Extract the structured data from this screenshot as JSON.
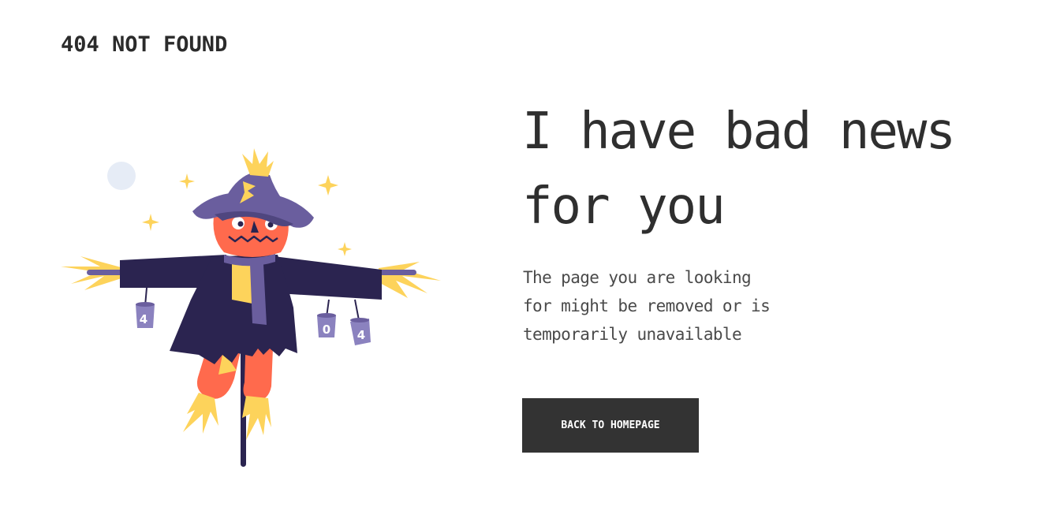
{
  "header": {
    "brand_text": "404 NOT FOUND"
  },
  "main": {
    "headline_line1": "I have bad news",
    "headline_line2": "for you",
    "description_line1": "The page you are looking",
    "description_line2": "for might be removed or is",
    "description_line3": "temporarily unavailable",
    "cta_label": "BACK TO HOMEPAGE"
  },
  "illustration": {
    "can_left_label": "4",
    "can_middle_label": "0",
    "can_right_label": "4",
    "colors": {
      "hat": "#6a5e9e",
      "hat_dark": "#4f467f",
      "coat": "#2b2450",
      "face": "#ff6a4d",
      "straw": "#fdd35b",
      "scarf": "#6a5e9e",
      "moon": "#e6ecf6",
      "pole": "#2b2450"
    }
  }
}
